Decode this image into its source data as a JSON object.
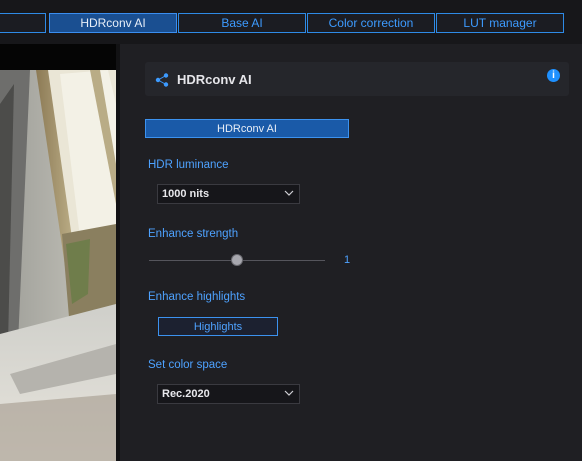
{
  "tabs": [
    {
      "label": ""
    },
    {
      "label": "HDRconv AI",
      "active": true
    },
    {
      "label": "Base AI"
    },
    {
      "label": "Color correction"
    },
    {
      "label": "LUT manager"
    }
  ],
  "panel": {
    "title": "HDRconv AI",
    "header_icon": "share-nodes-icon",
    "info_icon": "info-icon",
    "info_glyph": "i",
    "mode_button": "HDRconv AI",
    "hdr_luminance": {
      "label": "HDR luminance",
      "value": "1000 nits"
    },
    "enhance_strength": {
      "label": "Enhance strength",
      "value": "1",
      "level": 0.5
    },
    "enhance_highlights": {
      "label": "Enhance highlights",
      "button": "Highlights"
    },
    "color_space": {
      "label": "Set color space",
      "value": "Rec.2020"
    }
  },
  "colors": {
    "accent": "#3d9bff",
    "active_tab": "#1a4f91",
    "panel_bg": "#1f1f23"
  }
}
